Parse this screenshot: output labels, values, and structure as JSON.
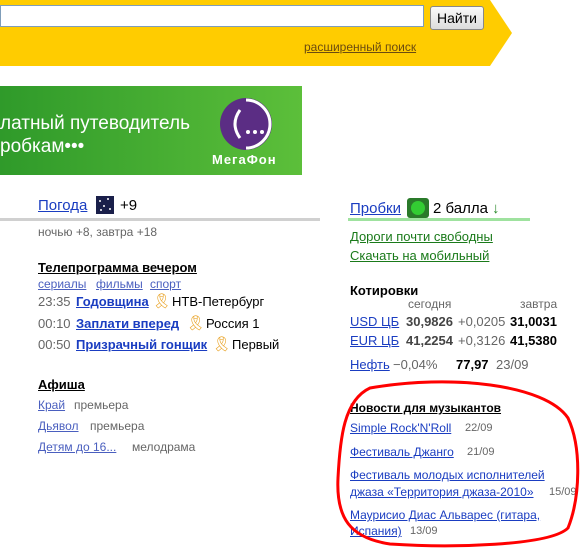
{
  "search": {
    "button": "Найти",
    "advanced": "расширенный поиск"
  },
  "banner": {
    "line1": "латный путеводитель",
    "line2": "робкам•••",
    "brand": "МегаФон"
  },
  "weather": {
    "title": "Погода",
    "temp": "+9",
    "forecast": "ночью +8, завтра +18"
  },
  "tv": {
    "title": "Телепрограмма вечером",
    "filters": [
      "сериалы",
      "фильмы",
      "спорт"
    ],
    "items": [
      {
        "time": "23:35",
        "show": "Годовщина",
        "channel": "НТВ-Петербург"
      },
      {
        "time": "00:10",
        "show": "Заплати вперед",
        "channel": "Россия 1"
      },
      {
        "time": "00:50",
        "show": "Призрачный гонщик",
        "channel": "Первый"
      }
    ]
  },
  "afisha": {
    "title": "Афиша",
    "items": [
      {
        "name": "Край",
        "note": "премьера"
      },
      {
        "name": "Дьявол",
        "note": "премьера"
      },
      {
        "name": "Детям до 16...",
        "note": "мелодрама"
      }
    ]
  },
  "traffic": {
    "title": "Пробки",
    "score": "2 балла",
    "arrow": "↓",
    "link1": "Дороги почти свободны",
    "link2": "Скачать на мобильный"
  },
  "quotes": {
    "title": "Котировки",
    "col_today": "сегодня",
    "col_tomorrow": "завтра",
    "rows": [
      {
        "name": "USD ЦБ",
        "today": "30,9826",
        "change": "+0,0205",
        "tomorrow": "31,0031"
      },
      {
        "name": "EUR ЦБ",
        "today": "41,2254",
        "change": "+0,3126",
        "tomorrow": "41,5380"
      }
    ],
    "oil": {
      "name": "Нефть",
      "change": "−0,04%",
      "value": "77,97",
      "date": "23/09"
    }
  },
  "news": {
    "title": "Новости для музыкантов",
    "items": [
      {
        "text": "Simple Rock'N'Roll",
        "date": "22/09"
      },
      {
        "text": "Фестиваль Джанго",
        "date": "21/09"
      },
      {
        "line1": "Фестиваль молодых исполнителей",
        "line2": "джаза «Территория джаза-2010»",
        "date": "15/09"
      },
      {
        "line1": "Маурисио Диас Альварес (гитара,",
        "line2": "Испания)",
        "date": "13/09"
      }
    ],
    "highlight_color": "#ff0000"
  }
}
